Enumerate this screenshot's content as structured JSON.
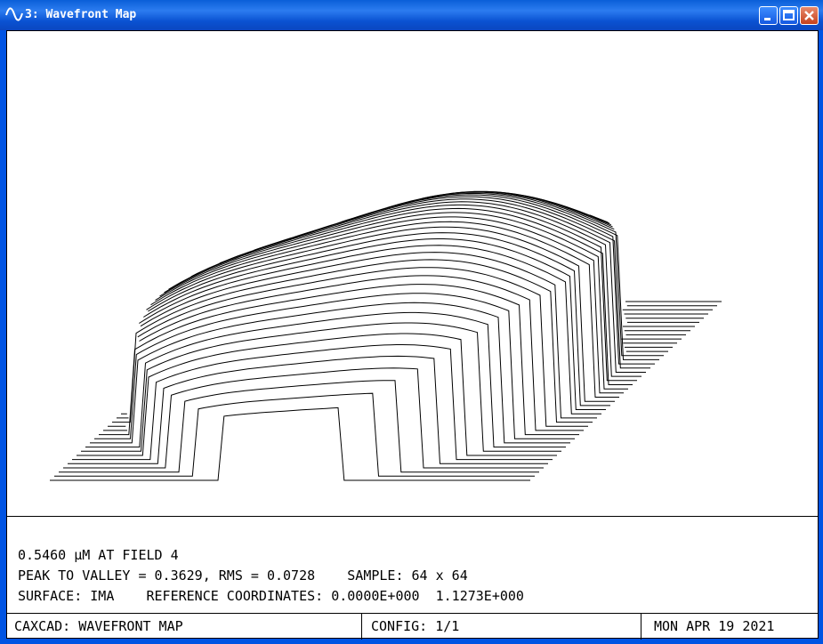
{
  "window": {
    "title": "3: Wavefront Map",
    "buttons": [
      "minimize",
      "maximize",
      "close"
    ],
    "title_bar_color": "#0a52d2"
  },
  "plot": {
    "description_icon": "surface-wireframe",
    "line_color": "#000000"
  },
  "info": {
    "line1": "0.5460 µM AT FIELD 4",
    "line2": "PEAK TO VALLEY = 0.3629, RMS = 0.0728    SAMPLE: 64 x 64",
    "line3": "SURFACE: IMA    REFERENCE COORDINATES: 0.0000E+000  1.1273E+000"
  },
  "status_bar": {
    "left": "CAXCAD: WAVEFRONT MAP",
    "center": "CONFIG: 1/1",
    "right": "MON APR 19 2021"
  }
}
